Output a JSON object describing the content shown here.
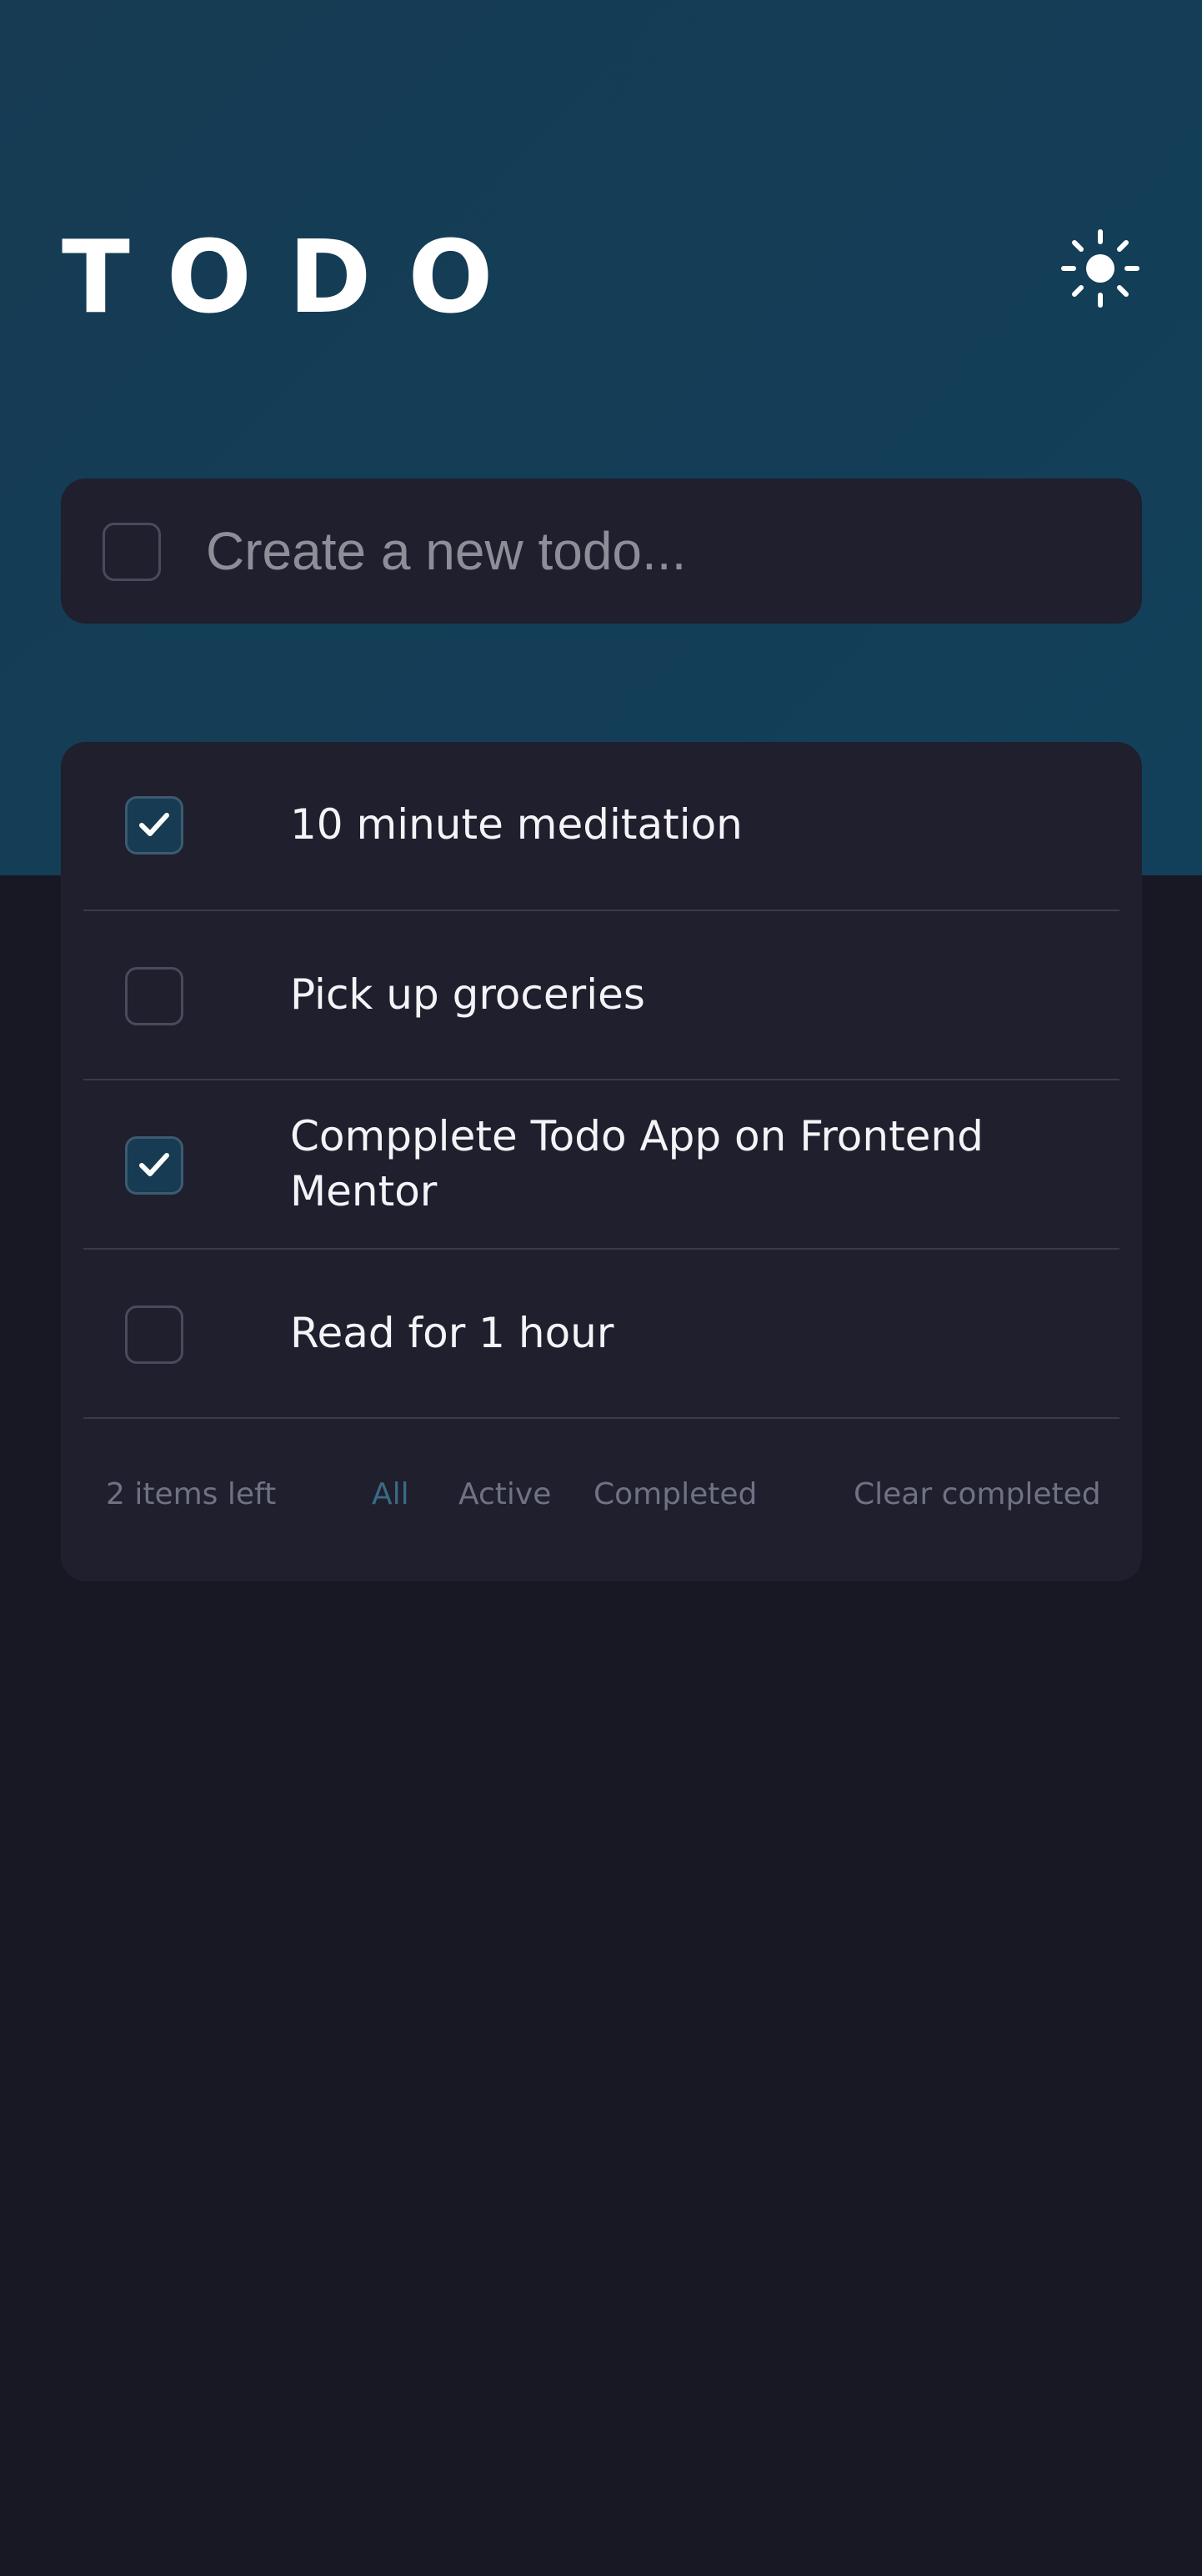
{
  "header": {
    "title": "TODO",
    "theme_icon": "sun-icon"
  },
  "new_todo": {
    "placeholder": "Create a new todo...",
    "value": ""
  },
  "todos": [
    {
      "text": "10 minute meditation",
      "completed": true
    },
    {
      "text": "Pick up groceries",
      "completed": false
    },
    {
      "text": "Compplete Todo App on Frontend Mentor",
      "completed": true
    },
    {
      "text": "Read for 1 hour",
      "completed": false
    }
  ],
  "footer": {
    "items_left": "2 items left",
    "filters": [
      "All",
      "Active",
      "Completed"
    ],
    "active_filter": "All",
    "clear_label": "Clear completed"
  },
  "colors": {
    "hero_bg": "#163b53",
    "page_bg": "#181824",
    "card_bg": "#1f1f2d",
    "active_filter": "#3a6a86"
  }
}
